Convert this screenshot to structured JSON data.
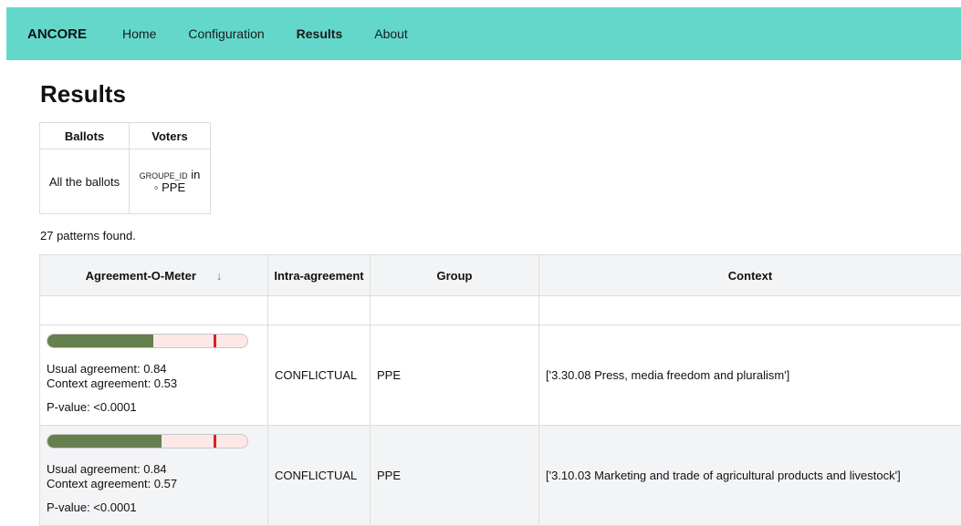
{
  "navbar": {
    "brand": "ANCORE",
    "items": [
      "Home",
      "Configuration",
      "Results",
      "About"
    ]
  },
  "page": {
    "title": "Results"
  },
  "filters": {
    "headers": [
      "Ballots",
      "Voters"
    ],
    "ballots": "All the ballots",
    "voters_attr": "GROUPE_ID",
    "voters_op": "in",
    "voters_value": "PPE"
  },
  "patterns_count": "27 patterns found.",
  "results": {
    "headers": {
      "agreement": "Agreement-O-Meter",
      "intra": "Intra-agreement",
      "group": "Group",
      "context": "Context"
    },
    "sort_icon": "arrow-down-icon",
    "rows": [
      {
        "usual_agreement": 0.84,
        "context_agreement": 0.53,
        "usual_label": "Usual agreement: 0.84",
        "context_label": "Context agreement: 0.53",
        "pvalue_label": "P-value: <0.0001",
        "intra": "CONFLICTUAL",
        "group": "PPE",
        "context": "['3.30.08 Press, media freedom and pluralism']"
      },
      {
        "usual_agreement": 0.84,
        "context_agreement": 0.57,
        "usual_label": "Usual agreement: 0.84",
        "context_label": "Context agreement: 0.57",
        "pvalue_label": "P-value: <0.0001",
        "intra": "CONFLICTUAL",
        "group": "PPE",
        "context": "['3.10.03 Marketing and trade of agricultural products and livestock']"
      }
    ]
  },
  "colors": {
    "navbar": "#64d7cb",
    "meter_fill": "#667f4e",
    "meter_bg": "#fde7e7",
    "meter_mark": "#d42323",
    "header_bg": "#f3f4f6"
  }
}
